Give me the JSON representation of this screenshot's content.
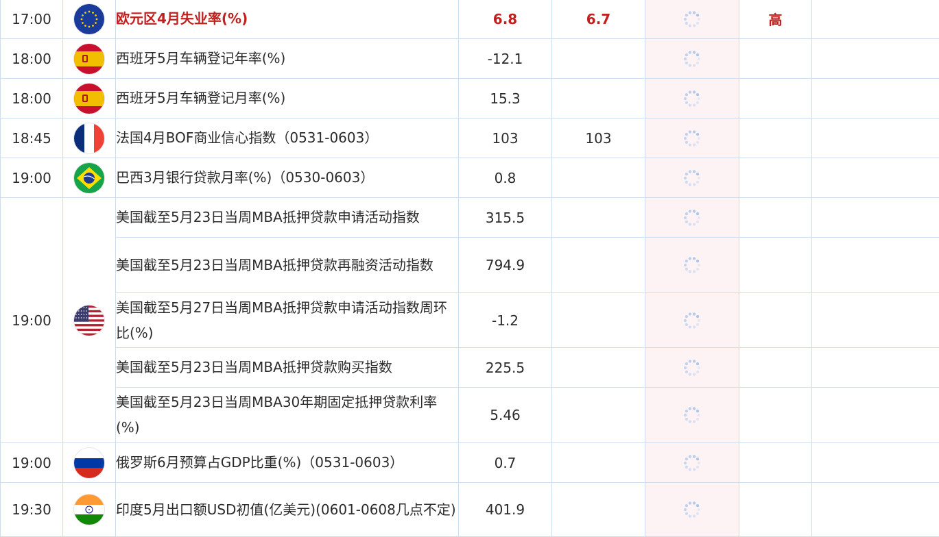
{
  "colors": {
    "highlight": "#c0211e",
    "border": "#cfdcea",
    "actual_bg": "#fdf3f4",
    "spinner": "#a9c6ec"
  },
  "rows": [
    {
      "time": "17:00",
      "flag": "eu-flag-icon",
      "rowspan": 1,
      "highlight": true,
      "items": [
        {
          "name": "欧元区4月失业率(%)",
          "prev": "6.8",
          "forecast": "6.7",
          "importance": "高"
        }
      ]
    },
    {
      "time": "18:00",
      "flag": "spain-flag-icon",
      "rowspan": 1,
      "items": [
        {
          "name": "西班牙5月车辆登记年率(%)",
          "prev": "-12.1",
          "forecast": "",
          "importance": ""
        }
      ]
    },
    {
      "time": "18:00",
      "flag": "spain-flag-icon",
      "rowspan": 1,
      "items": [
        {
          "name": "西班牙5月车辆登记月率(%)",
          "prev": "15.3",
          "forecast": "",
          "importance": ""
        }
      ]
    },
    {
      "time": "18:45",
      "flag": "france-flag-icon",
      "rowspan": 1,
      "items": [
        {
          "name": "法国4月BOF商业信心指数（0531-0603）",
          "prev": "103",
          "forecast": "103",
          "importance": ""
        }
      ]
    },
    {
      "time": "19:00",
      "flag": "brazil-flag-icon",
      "rowspan": 1,
      "items": [
        {
          "name": "巴西3月银行贷款月率(%)（0530-0603）",
          "prev": "0.8",
          "forecast": "",
          "importance": ""
        }
      ]
    },
    {
      "time": "19:00",
      "flag": "usa-flag-icon",
      "rowspan": 5,
      "items": [
        {
          "name": "美国截至5月23日当周MBA抵押贷款申请活动指数",
          "prev": "315.5",
          "forecast": "",
          "importance": ""
        },
        {
          "name": "美国截至5月23日当周MBA抵押贷款再融资活动指数",
          "prev": "794.9",
          "forecast": "",
          "importance": ""
        },
        {
          "name": "美国截至5月27日当周MBA抵押贷款申请活动指数周环比(%)",
          "prev": "-1.2",
          "forecast": "",
          "importance": ""
        },
        {
          "name": "美国截至5月23日当周MBA抵押贷款购买指数",
          "prev": "225.5",
          "forecast": "",
          "importance": ""
        },
        {
          "name": "美国截至5月23日当周MBA30年期固定抵押贷款利率(%)",
          "prev": "5.46",
          "forecast": "",
          "importance": ""
        }
      ]
    },
    {
      "time": "19:00",
      "flag": "russia-flag-icon",
      "rowspan": 1,
      "items": [
        {
          "name": "俄罗斯6月预算占GDP比重(%)（0531-0603）",
          "prev": "0.7",
          "forecast": "",
          "importance": ""
        }
      ]
    },
    {
      "time": "19:30",
      "flag": "india-flag-icon",
      "rowspan": 1,
      "items": [
        {
          "name": "印度5月出口额USD初值(亿美元)(0601-0608几点不定)",
          "prev": "401.9",
          "forecast": "",
          "importance": ""
        }
      ]
    }
  ]
}
